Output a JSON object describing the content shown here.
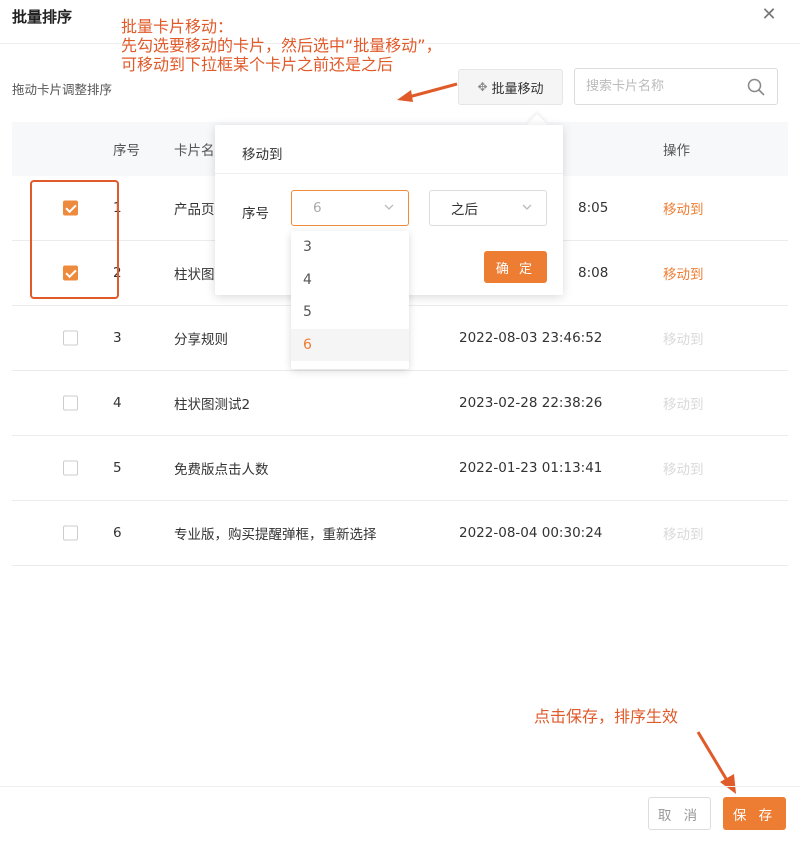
{
  "modal": {
    "title": "批量排序",
    "subtitle": "拖动卡片调整排序",
    "batch_move_label": "批量移动",
    "search_placeholder": "搜索卡片名称"
  },
  "table": {
    "headers": {
      "index": "序号",
      "name": "卡片名",
      "operation": "操作"
    },
    "rows": [
      {
        "index": "1",
        "name": "产品页",
        "time": "8:05",
        "op": "移动到",
        "checked": true
      },
      {
        "index": "2",
        "name": "柱状图",
        "time": "8:08",
        "op": "移动到",
        "checked": true
      },
      {
        "index": "3",
        "name": "分享规则",
        "time": "2022-08-03 23:46:52",
        "op": "移动到",
        "checked": false
      },
      {
        "index": "4",
        "name": "柱状图测试2",
        "time": "2023-02-28 22:38:26",
        "op": "移动到",
        "checked": false
      },
      {
        "index": "5",
        "name": "免费版点击人数",
        "time": "2022-01-23 01:13:41",
        "op": "移动到",
        "checked": false
      },
      {
        "index": "6",
        "name": "专业版，购买提醒弹框，重新选择",
        "time": "2022-08-04 00:30:24",
        "op": "移动到",
        "checked": false
      }
    ]
  },
  "popover": {
    "title": "移动到",
    "index_label": "序号",
    "index_value": "6",
    "position_value": "之后",
    "confirm_label": "确 定",
    "options": [
      "3",
      "4",
      "5",
      "6"
    ],
    "selected_option": "6"
  },
  "annotations": {
    "batch_move_line1": "批量卡片移动：",
    "batch_move_line2": "先勾选要移动的卡片，然后选中“批量移动”，",
    "batch_move_line3": "可移动到下拉框某个卡片之前还是之后",
    "save_note": "点击保存，排序生效"
  },
  "footer": {
    "cancel_label": "取 消",
    "save_label": "保 存"
  },
  "colors": {
    "accent": "#ee7d34",
    "annotation": "#e05a2a"
  }
}
